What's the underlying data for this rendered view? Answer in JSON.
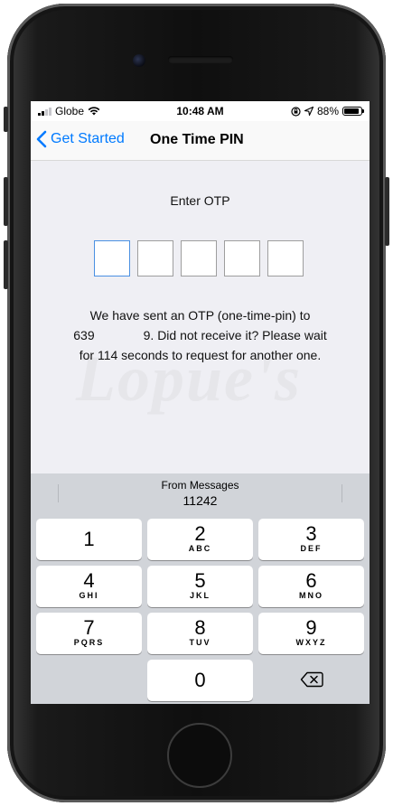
{
  "status_bar": {
    "carrier": "Globe",
    "time": "10:48 AM",
    "battery_text": "88%",
    "battery_level": 0.88
  },
  "nav": {
    "back_label": "Get Started",
    "title": "One Time PIN"
  },
  "otp": {
    "label": "Enter OTP",
    "digits": 5,
    "message_line1": "We have sent an OTP (one-time-pin) to",
    "message_phone_prefix": "639",
    "message_phone_suffix": "9. Did not receive it? Please wait",
    "message_line3": "for 114 seconds to request for another one."
  },
  "watermark": "Lopue's",
  "keyboard": {
    "suggestion_source": "From Messages",
    "suggestion_code": "11242",
    "keys": [
      {
        "num": "1",
        "letters": ""
      },
      {
        "num": "2",
        "letters": "ABC"
      },
      {
        "num": "3",
        "letters": "DEF"
      },
      {
        "num": "4",
        "letters": "GHI"
      },
      {
        "num": "5",
        "letters": "JKL"
      },
      {
        "num": "6",
        "letters": "MNO"
      },
      {
        "num": "7",
        "letters": "PQRS"
      },
      {
        "num": "8",
        "letters": "TUV"
      },
      {
        "num": "9",
        "letters": "WXYZ"
      },
      {
        "num": "0",
        "letters": ""
      }
    ]
  },
  "colors": {
    "accent": "#007aff",
    "background": "#efeff4",
    "keyboard": "#d1d4d9",
    "active_box_border": "#4a90e2"
  }
}
